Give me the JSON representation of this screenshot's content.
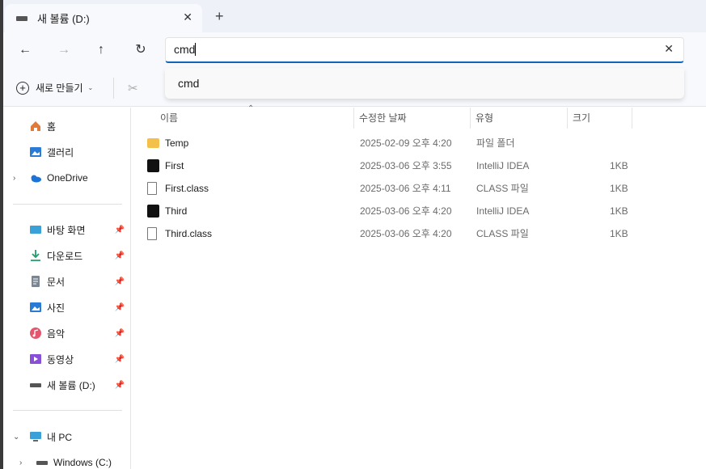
{
  "tab": {
    "title": "새 볼륨 (D:)",
    "close": "✕",
    "new": "+"
  },
  "nav": {
    "back": "←",
    "forward": "→",
    "up": "↑",
    "refresh": "↻"
  },
  "search": {
    "value": "cmd",
    "clear": "✕",
    "suggestion": "cmd"
  },
  "toolbar": {
    "new_label": "새로 만들기",
    "new_plus": "+",
    "chevron": "⌄",
    "cut": "✂"
  },
  "sidebar": {
    "home": "홈",
    "gallery": "갤러리",
    "onedrive": "OneDrive",
    "desktop": "바탕 화면",
    "downloads": "다운로드",
    "documents": "문서",
    "pictures": "사진",
    "music": "음악",
    "videos": "동영상",
    "volume": "새 볼륨 (D:)",
    "thispc": "내 PC",
    "windows_c": "Windows  (C:)",
    "chevron_right": "›",
    "chevron_down": "⌄",
    "pin": "📌"
  },
  "columns": {
    "name": "이름",
    "modified": "수정한 날짜",
    "type": "유형",
    "size": "크기",
    "sort": "⌃"
  },
  "files": [
    {
      "name": "Temp",
      "modified": "2025-02-09 오후 4:20",
      "type": "파일 폴더",
      "size": ""
    },
    {
      "name": "First",
      "modified": "2025-03-06 오후 3:55",
      "type": "IntelliJ IDEA",
      "size": "1KB"
    },
    {
      "name": "First.class",
      "modified": "2025-03-06 오후 4:11",
      "type": "CLASS 파일",
      "size": "1KB"
    },
    {
      "name": "Third",
      "modified": "2025-03-06 오후 4:20",
      "type": "IntelliJ IDEA",
      "size": "1KB"
    },
    {
      "name": "Third.class",
      "modified": "2025-03-06 오후 4:20",
      "type": "CLASS 파일",
      "size": "1KB"
    }
  ],
  "colors": {
    "accent": "#1166b8",
    "folder": "#f3c14a",
    "titlebar": "#eef1f8"
  }
}
